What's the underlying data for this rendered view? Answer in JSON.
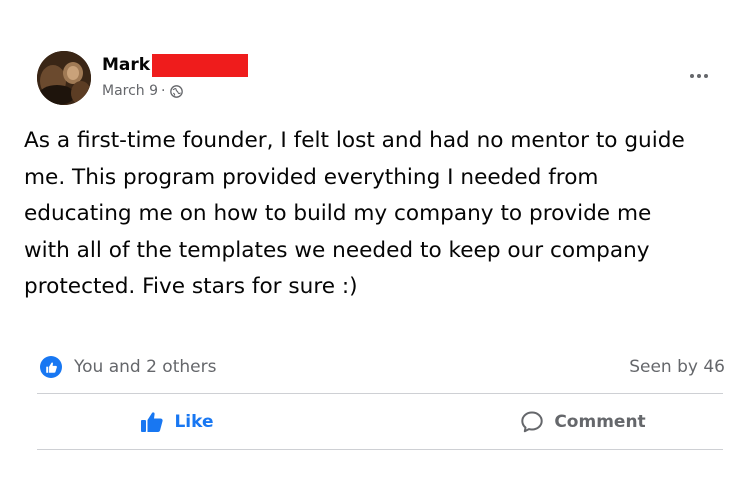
{
  "post": {
    "author_name": "Mark",
    "date": "March 9",
    "separator": "·",
    "audience_icon": "globe-icon",
    "more_icon": "more-horizontal-icon",
    "text_lines": [
      "As a first-time founder, I felt lost and had no mentor to guide",
      "me. This program provided everything I needed from",
      "educating me on how to build my company to provide me",
      "with all of the templates we needed to keep our company",
      "protected. Five stars for sure :)"
    ]
  },
  "reactions": {
    "icon": "like-reaction-icon",
    "summary": "You and 2 others",
    "seen_by": "Seen by 46"
  },
  "actions": {
    "like_label": "Like",
    "like_icon": "thumbs-up-icon",
    "comment_label": "Comment",
    "comment_icon": "comment-icon"
  },
  "colors": {
    "accent": "#1877f2",
    "secondary_text": "#65676b",
    "redaction": "#ef1c1c",
    "divider": "#ced0d4"
  }
}
